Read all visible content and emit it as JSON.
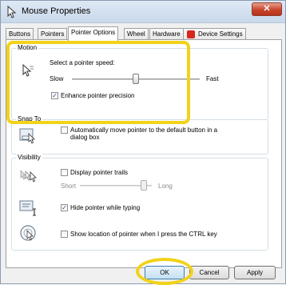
{
  "window": {
    "title": "Mouse Properties",
    "close_glyph": "✕"
  },
  "tabs": [
    {
      "label": "Buttons"
    },
    {
      "label": "Pointers"
    },
    {
      "label": "Pointer Options"
    },
    {
      "label": "Wheel"
    },
    {
      "label": "Hardware"
    },
    {
      "label": "Device Settings"
    }
  ],
  "motion": {
    "group_label": "Motion",
    "speed_label": "Select a pointer speed:",
    "slow_label": "Slow",
    "fast_label": "Fast",
    "speed_level": 0.5,
    "enhance_precision_label": "Enhance pointer precision",
    "enhance_precision_checked": true
  },
  "snap_to": {
    "group_label": "Snap To",
    "auto_move_label_line1": "Automatically move pointer to the default button in a",
    "auto_move_label_line2": "dialog box",
    "auto_move_checked": false
  },
  "visibility": {
    "group_label": "Visibility",
    "trails_label": "Display pointer trails",
    "trails_checked": false,
    "short_label": "Short",
    "long_label": "Long",
    "hide_typing_label": "Hide pointer while typing",
    "hide_typing_checked": true,
    "show_ctrl_label": "Show location of pointer when I press the CTRL key",
    "show_ctrl_checked": false
  },
  "footer": {
    "ok_label": "OK",
    "cancel_label": "Cancel",
    "apply_label": "Apply"
  },
  "colors": {
    "highlight": "#f2d21a",
    "close_button": "#c7442b"
  }
}
